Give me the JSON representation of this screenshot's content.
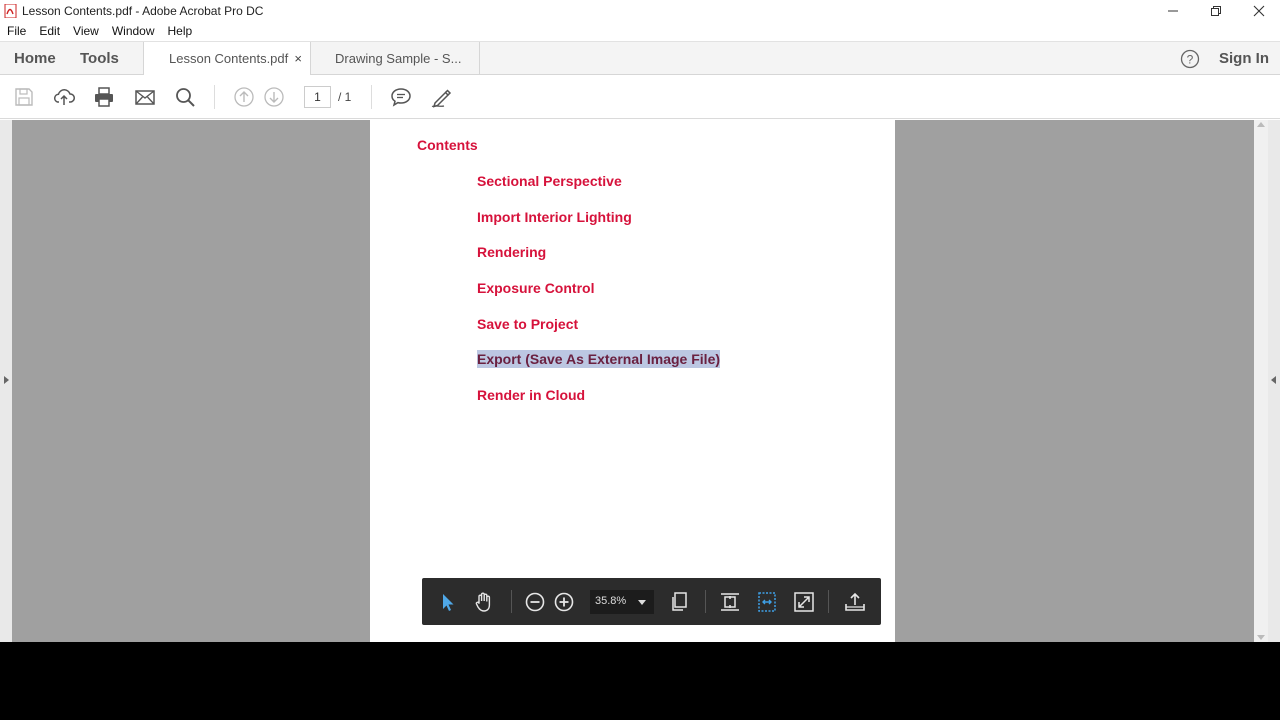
{
  "window": {
    "title": "Lesson Contents.pdf - Adobe Acrobat Pro DC",
    "controls": [
      "minimize-icon",
      "restore-icon",
      "close-icon"
    ]
  },
  "menu": {
    "file": "File",
    "edit": "Edit",
    "view": "View",
    "window": "Window",
    "help": "Help"
  },
  "tabs": {
    "home": "Home",
    "tools": "Tools",
    "docs": [
      {
        "label": "Lesson Contents.pdf",
        "close": "×",
        "active": true
      },
      {
        "label": "Drawing Sample - S...",
        "active": false
      }
    ],
    "sign_in": "Sign In"
  },
  "toolbar": {
    "icons": [
      "save-icon",
      "upload-icon",
      "print-icon",
      "mail-icon",
      "search-icon",
      "page-up-icon",
      "page-down-icon",
      "comment-icon",
      "pen-icon"
    ],
    "page_current": "1",
    "page_total": "/ 1"
  },
  "document": {
    "heading": "Contents",
    "items": [
      "Sectional Perspective",
      "Import Interior Lighting",
      "Rendering",
      "Exposure Control",
      "Save to Project",
      "Export (Save As External Image File)",
      "Render in Cloud"
    ],
    "selected_item": "Export (Save As External Image File)"
  },
  "floating_toolbar": {
    "zoom": "35.8%",
    "icons": [
      "select-arrow-icon",
      "hand-icon",
      "zoom-out-icon",
      "zoom-in-icon",
      "page-layout-icon",
      "fit-page-icon",
      "fit-width-icon",
      "fullscreen-icon",
      "share-icon"
    ]
  },
  "colors": {
    "accent_text": "#d6123b",
    "selection": "#bcc7e2",
    "workarea": "#a0a0a0",
    "float_bar": "#2c2c2c"
  }
}
